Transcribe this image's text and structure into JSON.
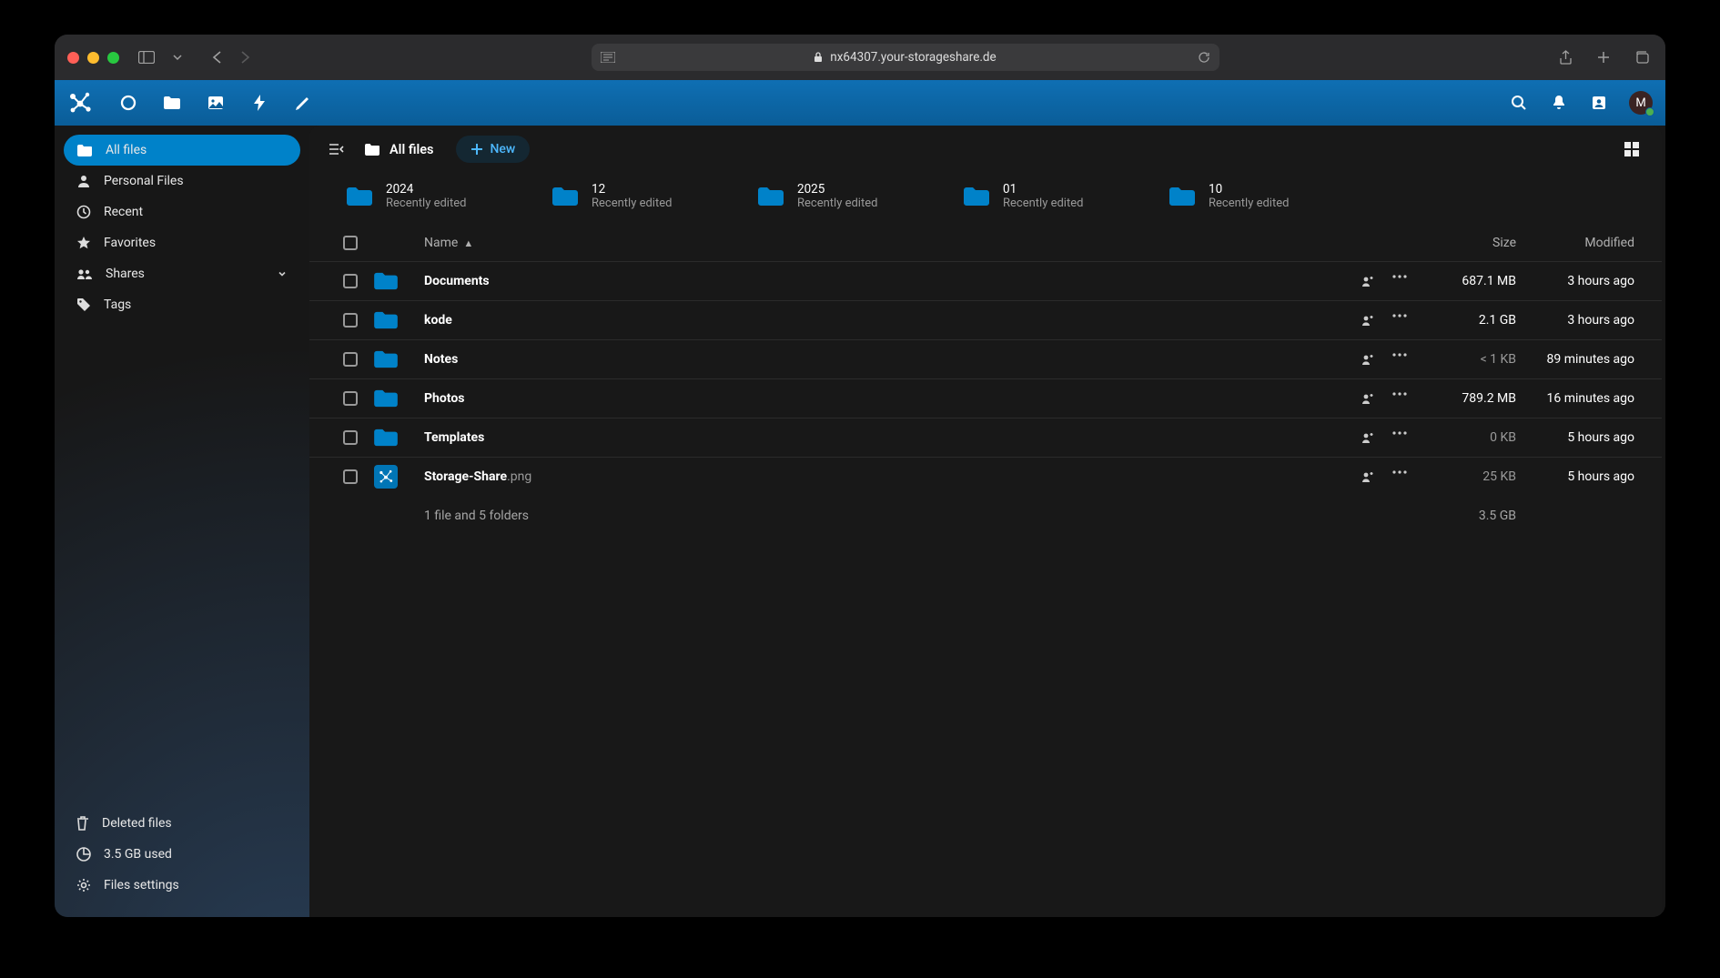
{
  "browser": {
    "url": "nx64307.your-storageshare.de"
  },
  "topbar": {
    "avatar_letter": "M"
  },
  "sidebar": {
    "items": [
      {
        "label": "All files"
      },
      {
        "label": "Personal Files"
      },
      {
        "label": "Recent"
      },
      {
        "label": "Favorites"
      },
      {
        "label": "Shares"
      },
      {
        "label": "Tags"
      }
    ],
    "bottom": {
      "deleted": "Deleted files",
      "storage": "3.5 GB used",
      "settings": "Files settings"
    }
  },
  "breadcrumb": {
    "label": "All files"
  },
  "new_button": "New",
  "recents": [
    {
      "name": "2024",
      "sub": "Recently edited"
    },
    {
      "name": "12",
      "sub": "Recently edited"
    },
    {
      "name": "2025",
      "sub": "Recently edited"
    },
    {
      "name": "01",
      "sub": "Recently edited"
    },
    {
      "name": "10",
      "sub": "Recently edited"
    }
  ],
  "headers": {
    "name": "Name",
    "size": "Size",
    "modified": "Modified"
  },
  "files": [
    {
      "name": "Documents",
      "ext": "",
      "type": "folder",
      "size": "687.1 MB",
      "size_faded": false,
      "modified": "3 hours ago"
    },
    {
      "name": "kode",
      "ext": "",
      "type": "folder",
      "size": "2.1 GB",
      "size_faded": false,
      "modified": "3 hours ago"
    },
    {
      "name": "Notes",
      "ext": "",
      "type": "folder",
      "size": "< 1 KB",
      "size_faded": true,
      "modified": "89 minutes ago"
    },
    {
      "name": "Photos",
      "ext": "",
      "type": "folder",
      "size": "789.2 MB",
      "size_faded": false,
      "modified": "16 minutes ago"
    },
    {
      "name": "Templates",
      "ext": "",
      "type": "folder",
      "size": "0 KB",
      "size_faded": true,
      "modified": "5 hours ago"
    },
    {
      "name": "Storage-Share",
      "ext": ".png",
      "type": "image",
      "size": "25 KB",
      "size_faded": true,
      "modified": "5 hours ago"
    }
  ],
  "summary": {
    "text": "1 file and 5 folders",
    "total": "3.5 GB"
  }
}
